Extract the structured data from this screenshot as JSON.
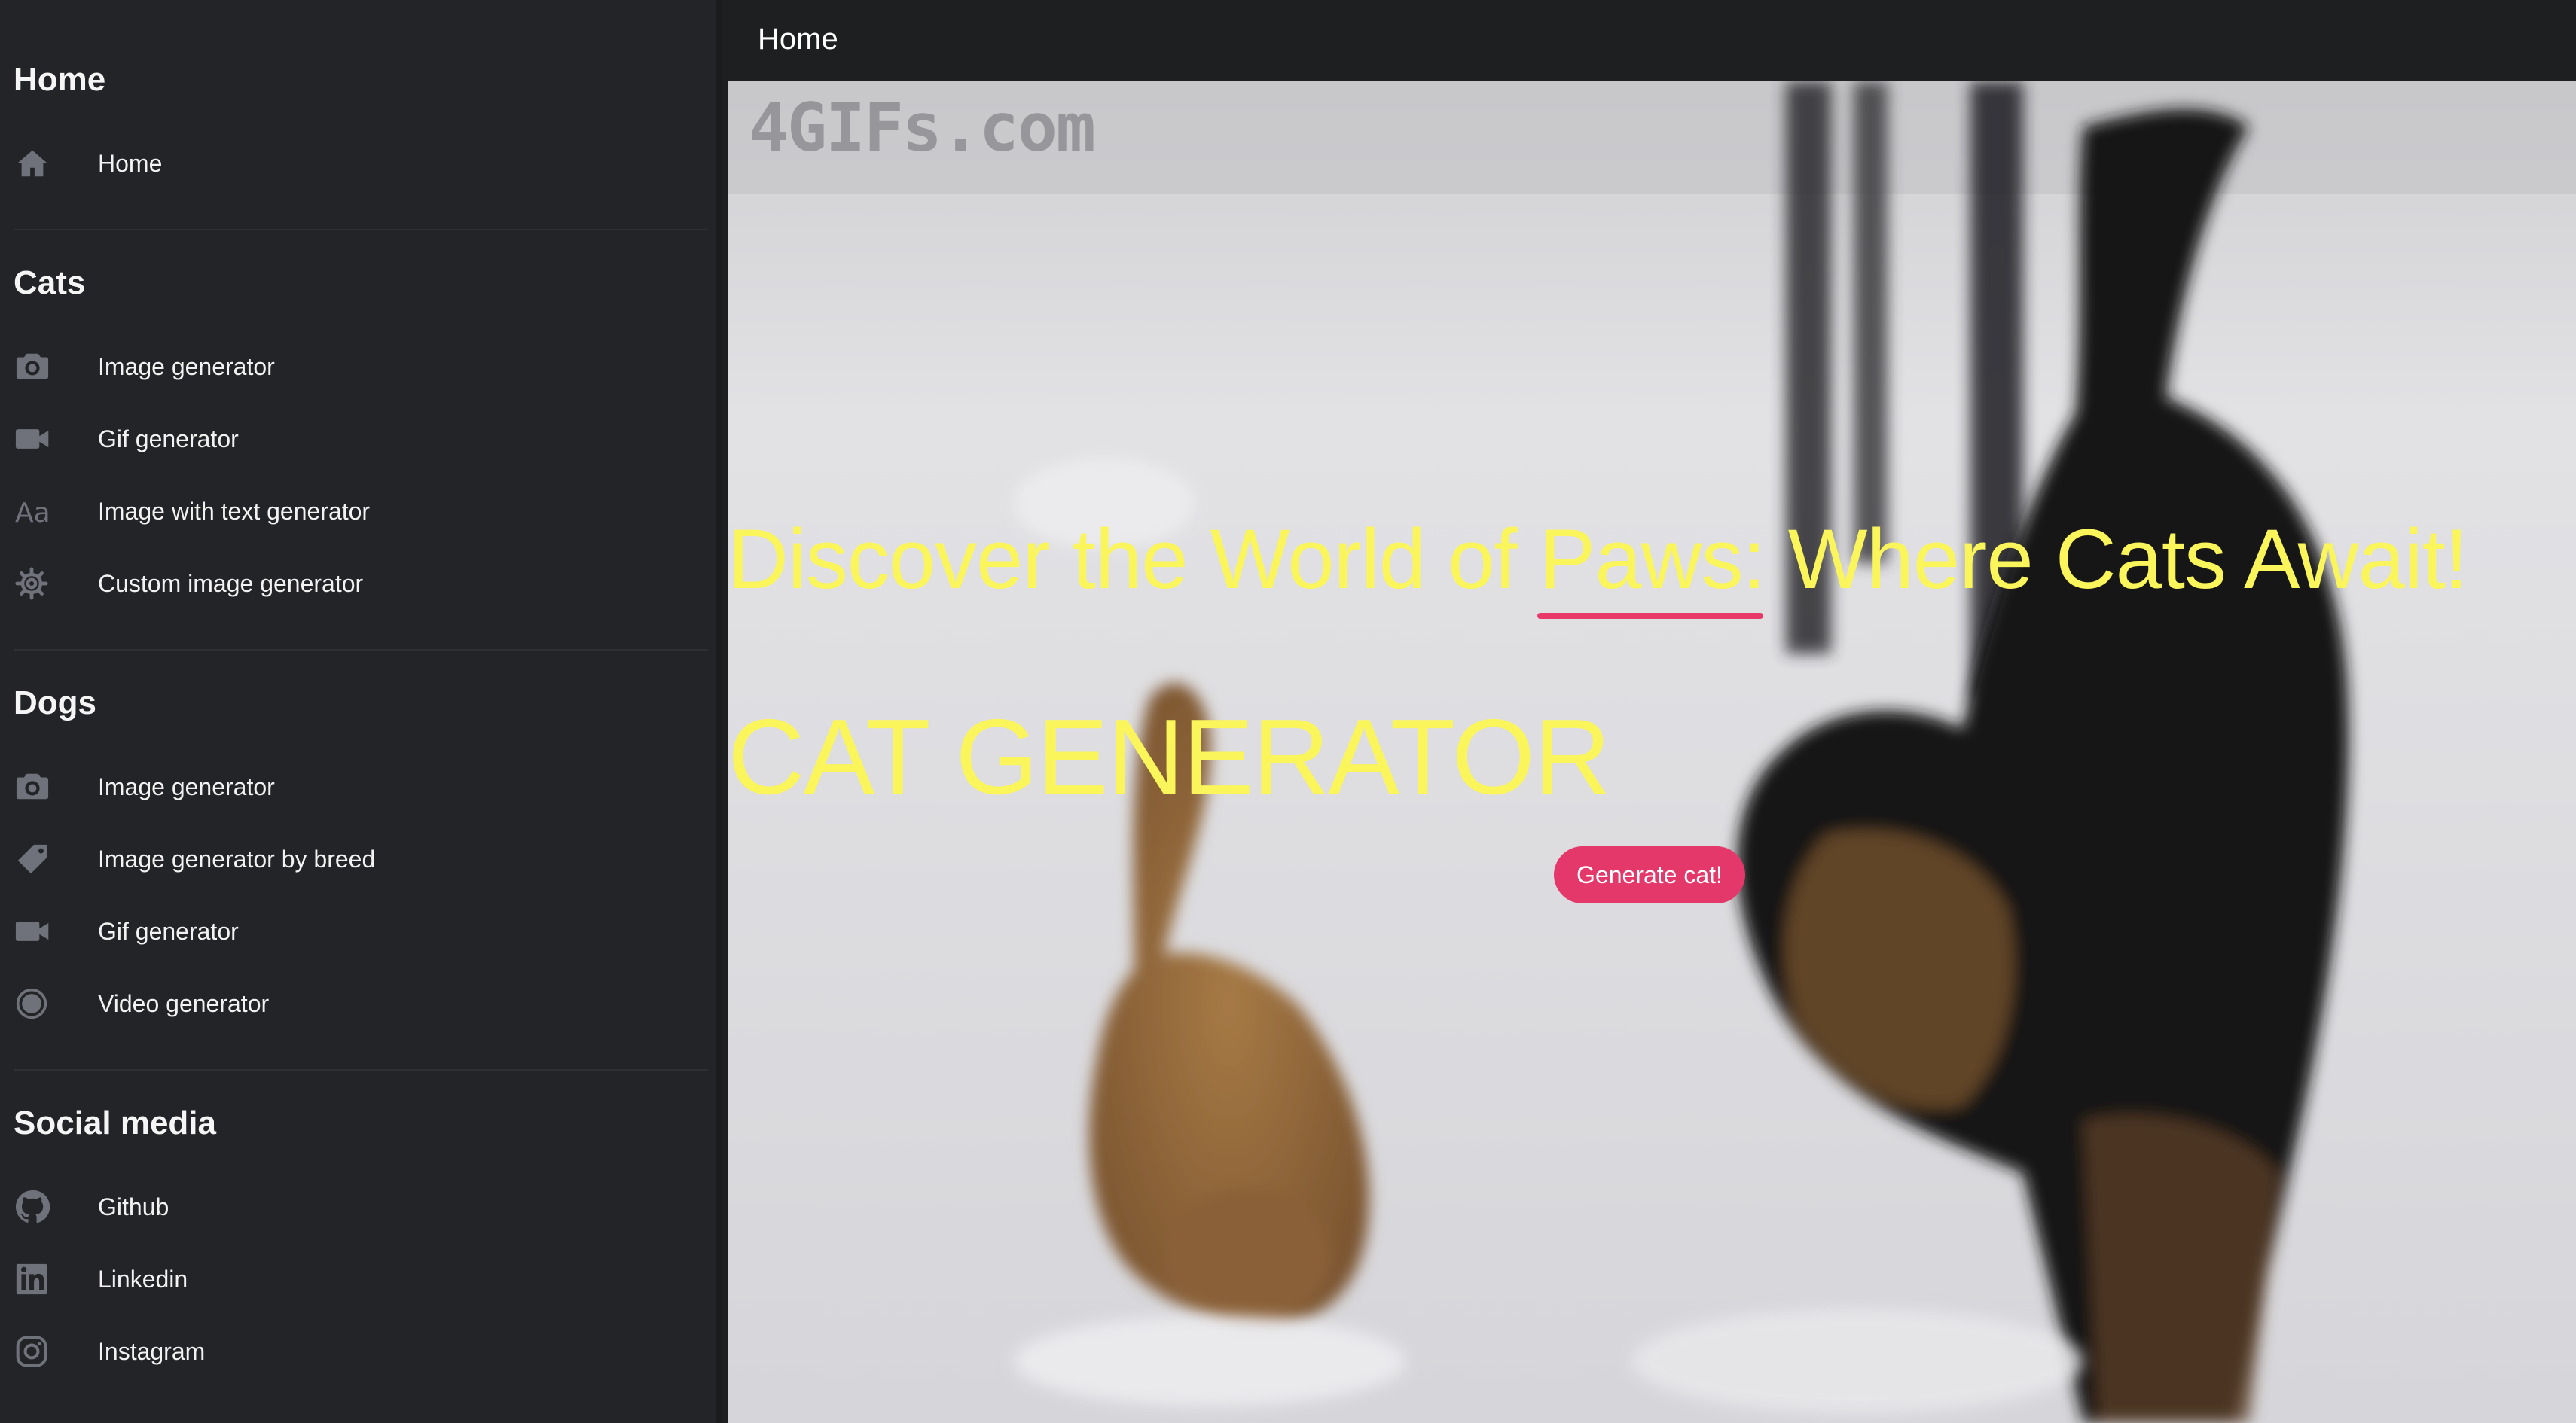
{
  "header": {
    "title": "Home"
  },
  "sidebar": {
    "sections": [
      {
        "title": "Home",
        "items": [
          {
            "label": "Home",
            "icon": "home-icon"
          }
        ]
      },
      {
        "title": "Cats",
        "items": [
          {
            "label": "Image generator",
            "icon": "camera-icon"
          },
          {
            "label": "Gif generator",
            "icon": "video-camera-icon"
          },
          {
            "label": "Image with text generator",
            "icon": "font-size-icon"
          },
          {
            "label": "Custom image generator",
            "icon": "gear-icon"
          }
        ]
      },
      {
        "title": "Dogs",
        "items": [
          {
            "label": "Image generator",
            "icon": "camera-icon"
          },
          {
            "label": "Image generator by breed",
            "icon": "tag-icon"
          },
          {
            "label": "Gif generator",
            "icon": "video-camera-icon"
          },
          {
            "label": "Video generator",
            "icon": "record-icon"
          }
        ]
      },
      {
        "title": "Social media",
        "items": [
          {
            "label": "Github",
            "icon": "github-icon"
          },
          {
            "label": "Linkedin",
            "icon": "linkedin-icon"
          },
          {
            "label": "Instagram",
            "icon": "instagram-icon"
          }
        ]
      }
    ]
  },
  "hero": {
    "watermark": "4GIFs.com",
    "tagline": "Discover the World of Paws: Where Cats Await!",
    "title": "CAT GENERATOR",
    "button_label": "Generate cat!"
  },
  "colors": {
    "accent": "#e4376a",
    "headline": "#faf55a",
    "sidebar_bg": "#232427",
    "icon": "#6f727a"
  }
}
